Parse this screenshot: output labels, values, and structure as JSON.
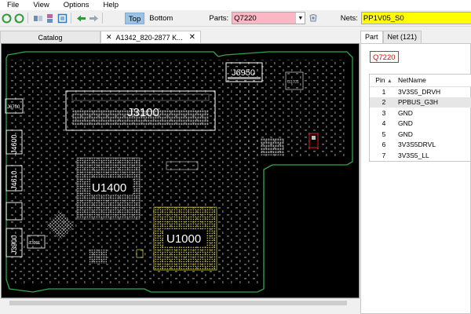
{
  "menu": {
    "items": [
      "File",
      "View",
      "Options",
      "Help"
    ]
  },
  "toolbar": {
    "view_top": "Top",
    "view_bottom": "Bottom",
    "parts_label": "Parts:",
    "parts_value": "Q7220",
    "nets_label": "Nets:",
    "nets_value": "PP1V05_S0"
  },
  "tabs": {
    "catalog": "Catalog",
    "board": "A1342_820-2877 K..."
  },
  "board": {
    "labels": {
      "j3100": "J3100",
      "j6950": "J6950",
      "u1400": "U1400",
      "u1000": "U1000",
      "j6700": "J6700",
      "j4600": "J4600",
      "j4610": "J4610",
      "j3900": "J3900",
      "u3701": "U3701",
      "t3901": "T3901"
    }
  },
  "right_panel": {
    "tab_part": "Part",
    "tab_net": "Net (121)",
    "part_name": "Q7220",
    "columns": [
      "Pin",
      "NetName"
    ],
    "rows": [
      {
        "pin": "1",
        "net": "3V3S5_DRVH"
      },
      {
        "pin": "2",
        "net": "PPBUS_G3H"
      },
      {
        "pin": "3",
        "net": "GND"
      },
      {
        "pin": "4",
        "net": "GND"
      },
      {
        "pin": "5",
        "net": "GND"
      },
      {
        "pin": "6",
        "net": "3V3S5DRVL"
      },
      {
        "pin": "7",
        "net": "3V3S5_LL"
      }
    ]
  },
  "colors": {
    "board_bg": "#000000",
    "outline": "#2fa84a",
    "parts_field": "#f9b8c4",
    "nets_field": "#ffff00",
    "highlight": "#d01010",
    "active_view": "#9cc3e6"
  }
}
